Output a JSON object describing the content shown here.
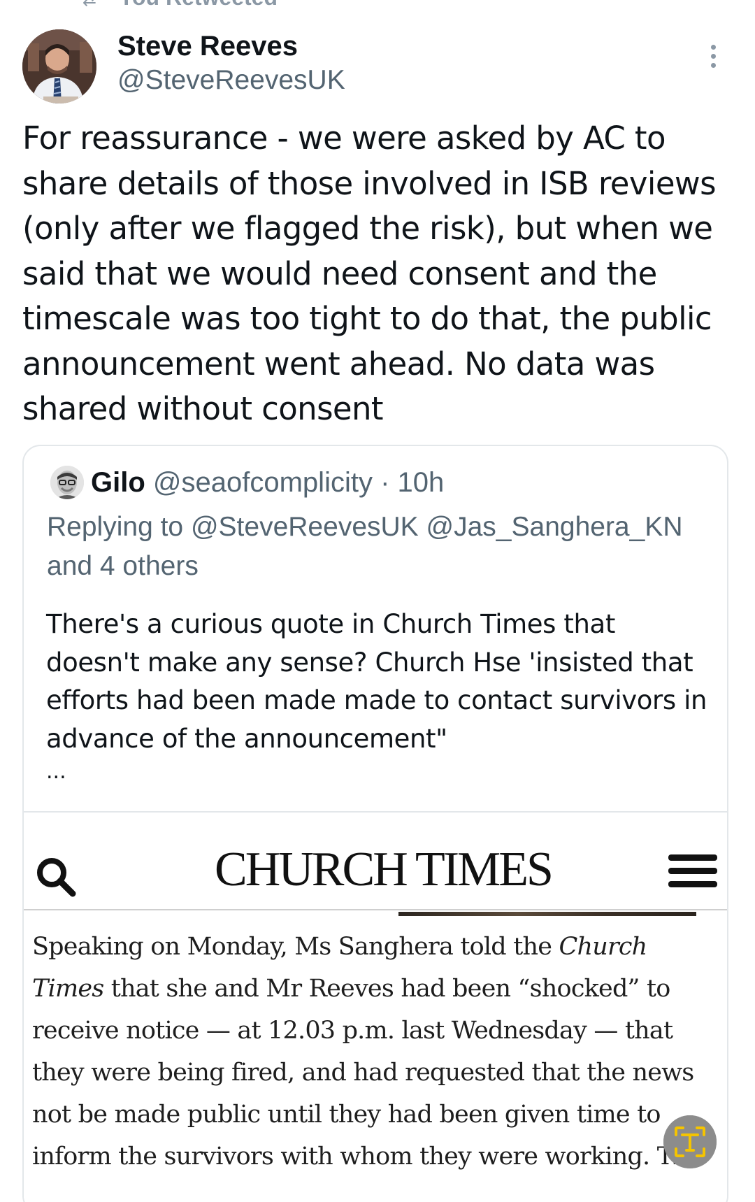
{
  "retweet_banner": {
    "text": "You Retweeted"
  },
  "author": {
    "display_name": "Steve Reeves",
    "handle": "@SteveReevesUK"
  },
  "tweet": {
    "text": "For reassurance - we were asked by AC to share details of those involved in ISB reviews (only after we flagged the risk), but when we said that we would need consent and the timescale was too tight to do that, the public announcement went ahead. No data was shared without consent"
  },
  "quoted_tweet": {
    "display_name": "Gilo",
    "handle": "@seaofcomplicity",
    "separator": "·",
    "time": "10h",
    "replying_to": "Replying to @SteveReevesUK @Jas_Sanghera_KN and 4 others",
    "text": "There's a curious quote in Church Times that doesn't make any sense? Church Hse 'insisted that efforts had been made made to contact survivors in advance of the announcement\"",
    "ellipsis": "...",
    "embedded_image": {
      "masthead": "CHURCH TIMES",
      "article_text_1": "Speaking on Monday, Ms Sanghera told the ",
      "article_italic_1": "Church Times",
      "article_text_2": " that she and Mr Reeves had been “shocked” to receive notice — at 12.03 p.m. last Wednesday — that they were being fired, and had requested that the news not be made public until they had been given time to inform the survivors with whom they were working. The"
    }
  },
  "icons": {
    "more": "more-vertical-icon",
    "search": "search-icon",
    "menu": "hamburger-menu-icon",
    "ocr": "text-recognition-icon"
  },
  "colors": {
    "primary_text": "#0f1419",
    "secondary_text": "#536471",
    "border": "#e3e7ea",
    "ocr_button": "#8c8c8c",
    "ocr_accent": "#f5c400"
  }
}
